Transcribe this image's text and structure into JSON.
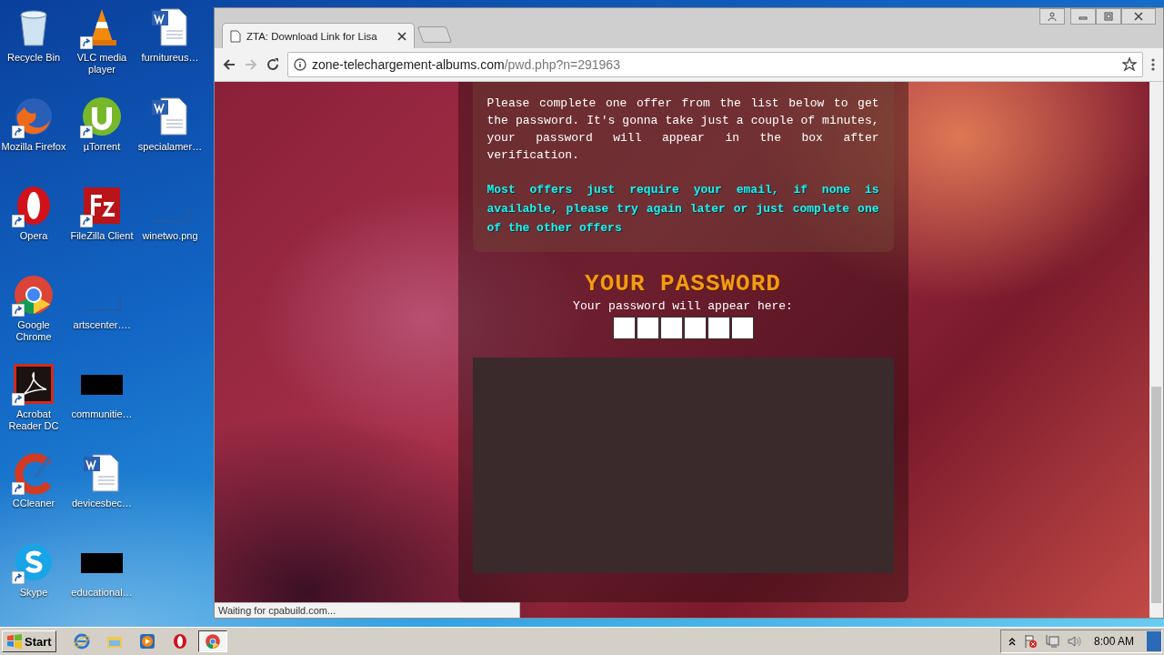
{
  "desktop_icons": [
    [
      {
        "kind": "recycle-bin",
        "label": "Recycle Bin",
        "shortcut": false
      },
      {
        "kind": "vlc",
        "label": "VLC media player",
        "shortcut": true
      },
      {
        "kind": "word-doc",
        "label": "furnitureus…",
        "shortcut": false
      }
    ],
    [
      {
        "kind": "firefox",
        "label": "Mozilla Firefox",
        "shortcut": true
      },
      {
        "kind": "utorrent",
        "label": "µTorrent",
        "shortcut": true
      },
      {
        "kind": "word-doc",
        "label": "specialamer…",
        "shortcut": false
      }
    ],
    [
      {
        "kind": "opera",
        "label": "Opera",
        "shortcut": true
      },
      {
        "kind": "filezilla",
        "label": "FileZilla Client",
        "shortcut": true
      },
      {
        "kind": "blank-image",
        "label": "winetwo.png",
        "shortcut": false
      }
    ],
    [
      {
        "kind": "chrome",
        "label": "Google Chrome",
        "shortcut": true
      },
      {
        "kind": "blank-image",
        "label": "artscenter….",
        "shortcut": false
      }
    ],
    [
      {
        "kind": "acrobat",
        "label": "Acrobat Reader DC",
        "shortcut": true
      },
      {
        "kind": "black-image",
        "label": "communitie…",
        "shortcut": false
      }
    ],
    [
      {
        "kind": "ccleaner",
        "label": "CCleaner",
        "shortcut": true
      },
      {
        "kind": "word-doc",
        "label": "devicesbec…",
        "shortcut": false
      }
    ],
    [
      {
        "kind": "skype",
        "label": "Skype",
        "shortcut": true
      },
      {
        "kind": "black-image",
        "label": "educational…",
        "shortcut": false
      }
    ]
  ],
  "browser": {
    "tabs": [
      {
        "title": "ZTA: Download Link for Lisa",
        "selected": true
      }
    ],
    "address": {
      "host": "zone-telechargement-albums.com",
      "path": "/pwd.php?n=291963"
    },
    "page": {
      "instructions": "Please complete one offer from the list below to get the password. It's gonna take just a couple of minutes, your password will appear in the box after verification.",
      "notice": "Most offers just require your email, if none is available, please try again later or just complete one of the other offers",
      "heading": "YOUR PASSWORD",
      "subheading": "Your password will appear here:"
    },
    "status": "Waiting for cpabuild.com..."
  },
  "taskbar": {
    "start": "Start",
    "apps": [
      {
        "kind": "ie",
        "selected": false
      },
      {
        "kind": "explorer",
        "selected": false
      },
      {
        "kind": "media",
        "selected": false
      },
      {
        "kind": "opera",
        "selected": false
      },
      {
        "kind": "chrome",
        "selected": true
      }
    ],
    "clock": "8:00 AM"
  }
}
